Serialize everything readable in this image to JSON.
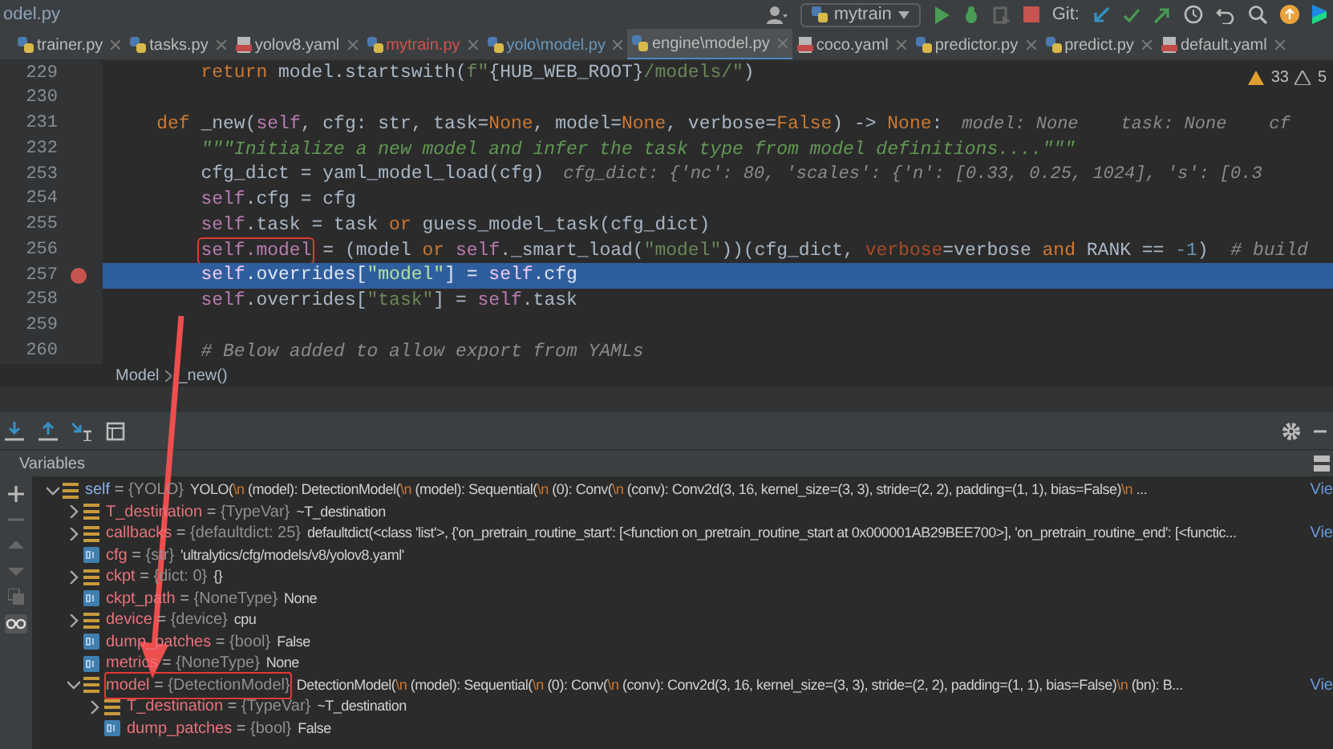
{
  "window": {
    "title": "odel.py"
  },
  "toolbar": {
    "run_config": "mytrain",
    "git_label": "Git:"
  },
  "tabs": [
    {
      "label": "trainer.py",
      "kind": "python",
      "color": "#bbbbbb",
      "selected": false
    },
    {
      "label": "tasks.py",
      "kind": "python",
      "color": "#bbbbbb",
      "selected": false
    },
    {
      "label": "yolov8.yaml",
      "kind": "yaml",
      "color": "#bbbbbb",
      "selected": false
    },
    {
      "label": "mytrain.py",
      "kind": "python",
      "color": "#d25252",
      "selected": false
    },
    {
      "label": "yolo\\model.py",
      "kind": "python",
      "color": "#6897bb",
      "selected": false
    },
    {
      "label": "engine\\model.py",
      "kind": "python",
      "color": "#bbbbbb",
      "selected": true
    },
    {
      "label": "coco.yaml",
      "kind": "yaml",
      "color": "#bbbbbb",
      "selected": false
    },
    {
      "label": "predictor.py",
      "kind": "python",
      "color": "#bbbbbb",
      "selected": false
    },
    {
      "label": "predict.py",
      "kind": "python",
      "color": "#bbbbbb",
      "selected": false
    },
    {
      "label": "default.yaml",
      "kind": "yaml",
      "color": "#bbbbbb",
      "selected": false
    }
  ],
  "editor": {
    "warnings": "33",
    "weak_warnings": "5",
    "lines": [
      {
        "number": "229",
        "breakpoint": false,
        "selected": false,
        "tokens": [
          {
            "text": "        return ",
            "kind": "keyword"
          },
          {
            "text": "model.startswith(",
            "kind": "plain"
          },
          {
            "text": "f\"",
            "kind": "string"
          },
          {
            "text": "{HUB_WEB_ROOT}",
            "kind": "plain"
          },
          {
            "text": "/models/\"",
            "kind": "string"
          },
          {
            "text": ")",
            "kind": "plain"
          }
        ]
      },
      {
        "number": "230",
        "breakpoint": false,
        "selected": false
      },
      {
        "number": "231",
        "breakpoint": false,
        "selected": false,
        "tokens": [
          {
            "text": "    def ",
            "kind": "keyword"
          },
          {
            "text": "_new(",
            "kind": "plain"
          },
          {
            "text": "self",
            "kind": "self"
          },
          {
            "text": ", cfg: str, task=",
            "kind": "plain"
          },
          {
            "text": "None",
            "kind": "keyword"
          },
          {
            "text": ", model=",
            "kind": "plain"
          },
          {
            "text": "None",
            "kind": "keyword"
          },
          {
            "text": ", verbose=",
            "kind": "plain"
          },
          {
            "text": "False",
            "kind": "keyword"
          },
          {
            "text": ") -> ",
            "kind": "plain"
          },
          {
            "text": "None",
            "kind": "keyword"
          },
          {
            "text": ":",
            "kind": "plain"
          },
          {
            "text": "model: None    task: None    cf",
            "kind": "hint"
          }
        ]
      },
      {
        "number": "232",
        "breakpoint": false,
        "selected": false,
        "tokens": [
          {
            "text": "        \"\"\"Initialize a new model and infer the task type from model definitions....\"\"\"",
            "kind": "doc"
          }
        ]
      },
      {
        "number": "253",
        "breakpoint": false,
        "selected": false,
        "tokens": [
          {
            "text": "        cfg_dict = yaml_model_load(cfg)",
            "kind": "plain"
          },
          {
            "text": "cfg_dict: {'nc': 80, 'scales': {'n': [0.33, 0.25, 1024], 's': [0.3",
            "kind": "hint"
          }
        ]
      },
      {
        "number": "254",
        "breakpoint": false,
        "selected": false,
        "tokens": [
          {
            "text": "        self",
            "kind": "self"
          },
          {
            "text": ".cfg = cfg",
            "kind": "plain"
          }
        ]
      },
      {
        "number": "255",
        "breakpoint": false,
        "selected": false,
        "tokens": [
          {
            "text": "        self",
            "kind": "self"
          },
          {
            "text": ".task = task ",
            "kind": "plain"
          },
          {
            "text": "or ",
            "kind": "keyword"
          },
          {
            "text": "guess_model_task(cfg_dict)",
            "kind": "plain"
          }
        ]
      },
      {
        "number": "256",
        "breakpoint": false,
        "selected": false,
        "tokens": [
          {
            "text": "        self.model",
            "kind": "self",
            "boxed": true
          },
          {
            "text": " = (model ",
            "kind": "plain",
            "boxed": false
          },
          {
            "text": "or ",
            "kind": "keyword"
          },
          {
            "text": "self",
            "kind": "self"
          },
          {
            "text": "._smart_load(",
            "kind": "plain"
          },
          {
            "text": "\"model\"",
            "kind": "string"
          },
          {
            "text": "))(cfg_dict, ",
            "kind": "plain"
          },
          {
            "text": "verbose",
            "kind": "param"
          },
          {
            "text": "=verbose ",
            "kind": "plain"
          },
          {
            "text": "and ",
            "kind": "keyword"
          },
          {
            "text": "RANK == ",
            "kind": "plain"
          },
          {
            "text": "-1",
            "kind": "number"
          },
          {
            "text": ")  ",
            "kind": "plain"
          },
          {
            "text": "# build",
            "kind": "comment"
          }
        ]
      },
      {
        "number": "257",
        "breakpoint": true,
        "selected": true,
        "tokens": [
          {
            "text": "        self",
            "kind": "self"
          },
          {
            "text": ".overrides[",
            "kind": "plain"
          },
          {
            "text": "\"model\"",
            "kind": "string"
          },
          {
            "text": "] = ",
            "kind": "plain"
          },
          {
            "text": "self",
            "kind": "self"
          },
          {
            "text": ".cfg",
            "kind": "plain"
          }
        ]
      },
      {
        "number": "258",
        "breakpoint": false,
        "selected": false,
        "tokens": [
          {
            "text": "        self",
            "kind": "self"
          },
          {
            "text": ".overrides[",
            "kind": "plain"
          },
          {
            "text": "\"task\"",
            "kind": "string"
          },
          {
            "text": "] = ",
            "kind": "plain"
          },
          {
            "text": "self",
            "kind": "self"
          },
          {
            "text": ".task",
            "kind": "plain"
          }
        ]
      },
      {
        "number": "259",
        "breakpoint": false,
        "selected": false
      },
      {
        "number": "260",
        "breakpoint": false,
        "selected": false,
        "tokens": [
          {
            "text": "        # Below added to allow export from YAMLs",
            "kind": "comment"
          }
        ]
      }
    ],
    "breadcrumbs": [
      "Model",
      "_new()"
    ]
  },
  "debugger": {
    "header": "Variables",
    "variables": [
      {
        "name": "self",
        "operator": "=",
        "type": "{YOLO}",
        "value": "YOLO(\\n  (model): DetectionModel(\\n    (model): Sequential(\\n      (0): Conv(\\n        (conv): Conv2d(3, 16, kernel_size=(3, 3), stride=(2, 2), padding=(1, 1), bias=False)\\n     ...",
        "link": "Vie",
        "kind": "object",
        "expanded": true,
        "boxed": false,
        "children": [
          {
            "name": "T_destination",
            "operator": "=",
            "type": "{TypeVar}",
            "value": "~T_destination",
            "kind": "object",
            "expanded": false,
            "boxed": false
          },
          {
            "name": "callbacks",
            "operator": "=",
            "type": "{defaultdict: 25}",
            "value": "defaultdict(<class 'list'>, {'on_pretrain_routine_start': [<function on_pretrain_routine_start at 0x000001AB29BEE700>], 'on_pretrain_routine_end': [<functic...",
            "link": "Vie",
            "kind": "object",
            "expanded": false,
            "boxed": false
          },
          {
            "name": "cfg",
            "operator": "=",
            "type": "{str}",
            "value": "'ultralytics/cfg/models/v8/yolov8.yaml'",
            "kind": "primitive",
            "boxed": false
          },
          {
            "name": "ckpt",
            "operator": "=",
            "type": "{dict: 0}",
            "value": "{}",
            "kind": "object",
            "expanded": false,
            "boxed": false
          },
          {
            "name": "ckpt_path",
            "operator": "=",
            "type": "{NoneType}",
            "value": "None",
            "kind": "primitive",
            "boxed": false
          },
          {
            "name": "device",
            "operator": "=",
            "type": "{device}",
            "value": "cpu",
            "kind": "object",
            "expanded": false,
            "boxed": false
          },
          {
            "name": "dump_patches",
            "operator": "=",
            "type": "{bool}",
            "value": "False",
            "kind": "primitive",
            "boxed": false
          },
          {
            "name": "metrics",
            "operator": "=",
            "type": "{NoneType}",
            "value": "None",
            "kind": "primitive",
            "boxed": false
          },
          {
            "name": "model",
            "operator": "=",
            "type": "{DetectionModel}",
            "value": "DetectionModel(\\n  (model): Sequential(\\n    (0): Conv(\\n      (conv): Conv2d(3, 16, kernel_size=(3, 3), stride=(2, 2), padding=(1, 1), bias=False)\\n     (bn): B...",
            "link": "Vie",
            "kind": "object",
            "expanded": true,
            "boxed": true,
            "children": [
              {
                "name": "T_destination",
                "operator": "=",
                "type": "{TypeVar}",
                "value": "~T_destination",
                "kind": "object",
                "expanded": false,
                "boxed": false
              },
              {
                "name": "dump_patches",
                "operator": "=",
                "type": "{bool}",
                "value": "False",
                "kind": "primitive",
                "boxed": false
              }
            ]
          }
        ]
      }
    ]
  }
}
